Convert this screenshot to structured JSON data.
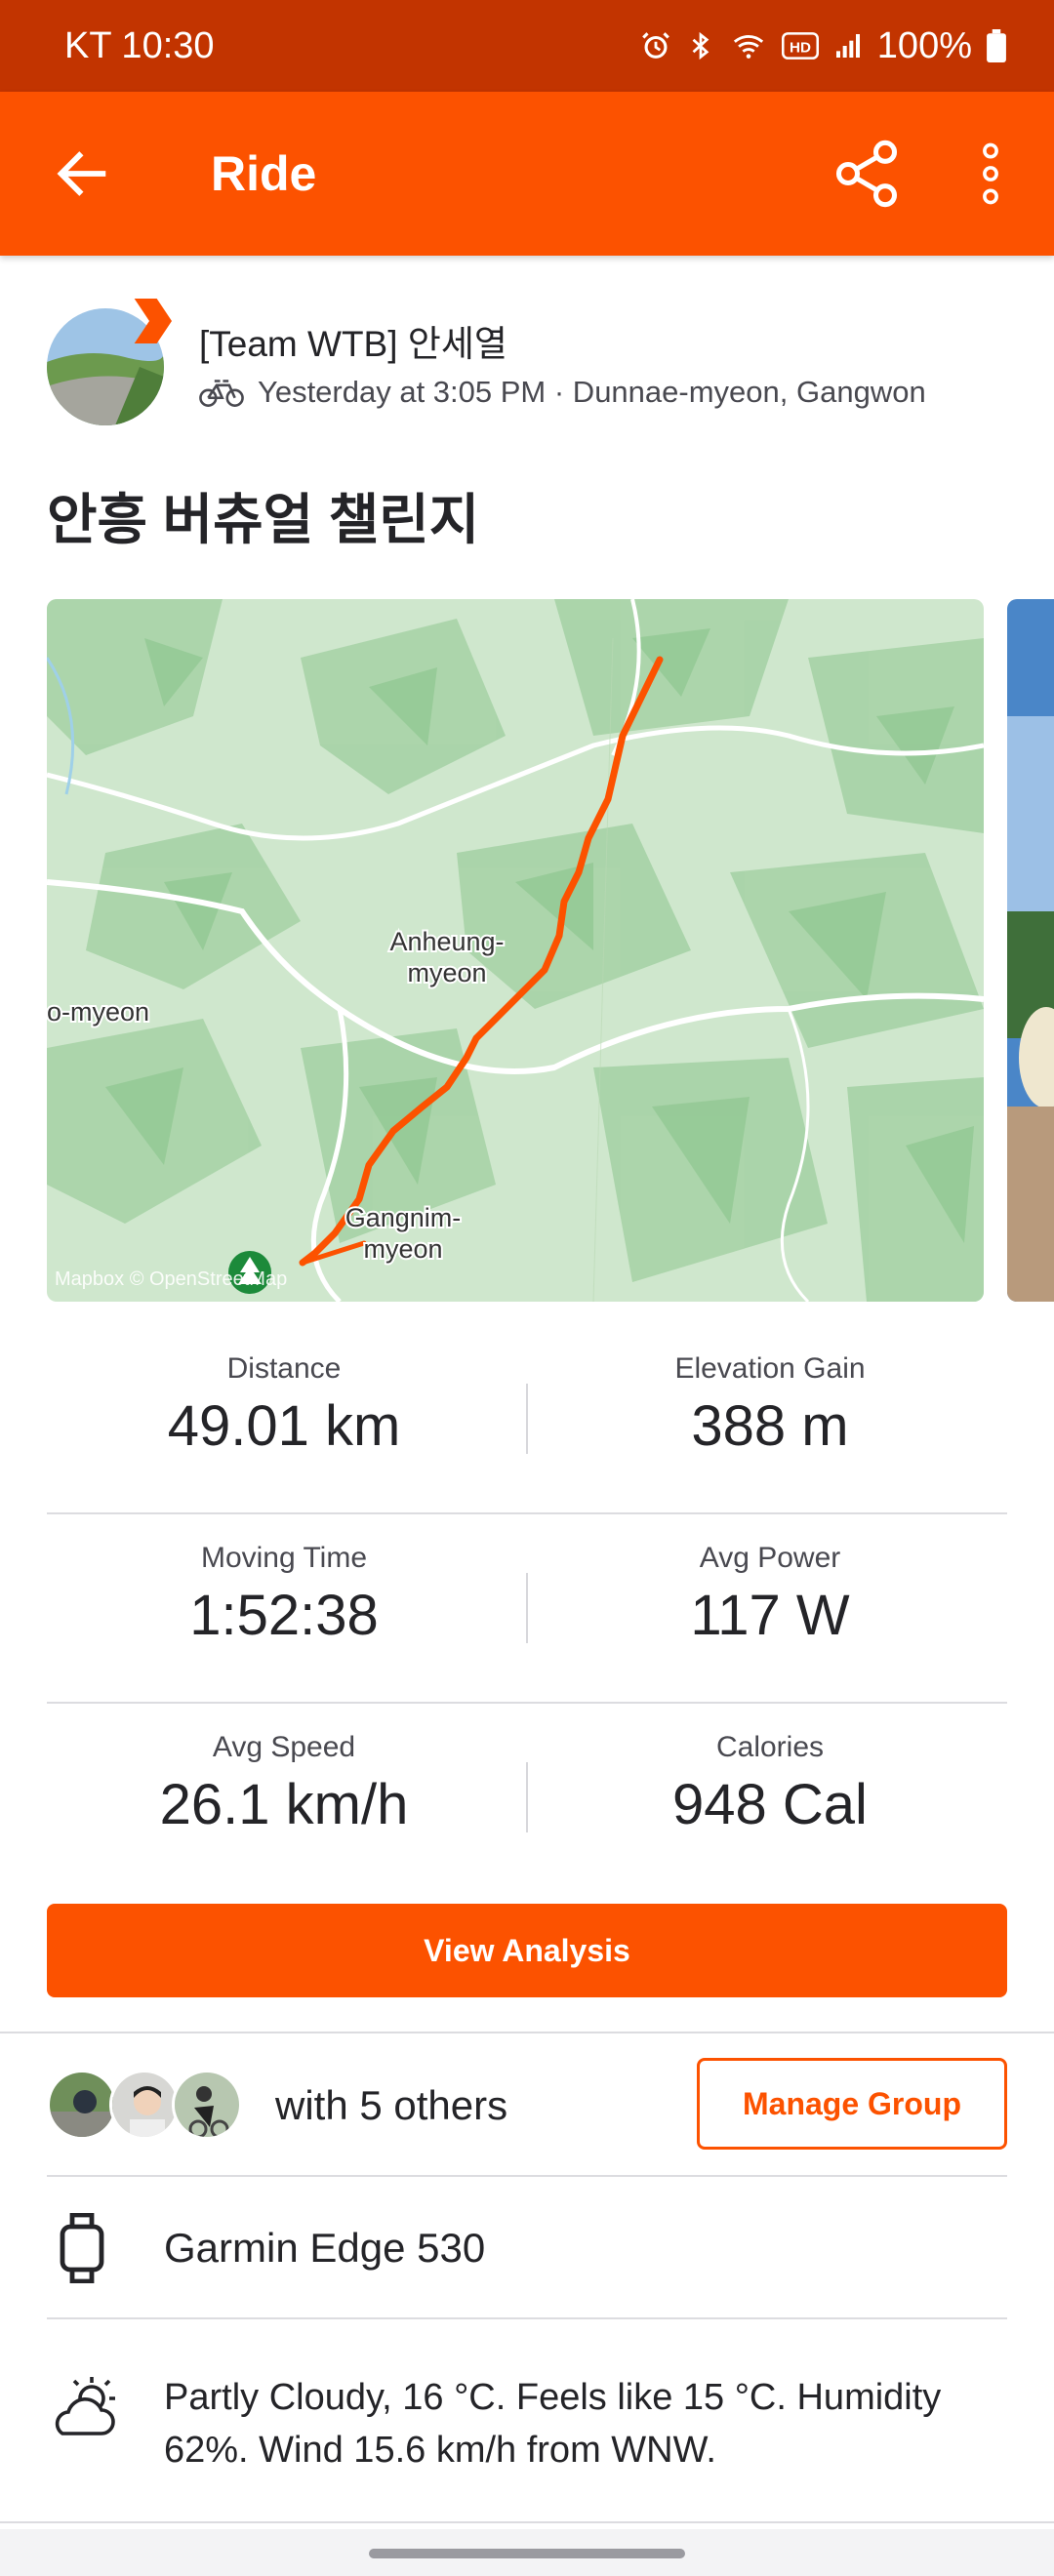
{
  "status_bar": {
    "carrier_time": "KT 10:30",
    "battery": "100%"
  },
  "app_bar": {
    "title": "Ride"
  },
  "activity": {
    "athlete_name": "[Team WTB] 안세열",
    "meta": "Yesterday at 3:05 PM · Dunnae-myeon, Gangwon",
    "title": "안흥 버츄얼 챌린지"
  },
  "map": {
    "labels": [
      "Anheung-",
      "myeon",
      "o-myeon",
      "Gangnim-",
      "myeon"
    ],
    "attribution": "Mapbox © OpenStreetMap"
  },
  "stats": [
    {
      "label": "Distance",
      "value": "49.01 km"
    },
    {
      "label": "Elevation Gain",
      "value": "388 m"
    },
    {
      "label": "Moving Time",
      "value": "1:52:38"
    },
    {
      "label": "Avg Power",
      "value": "117 W"
    },
    {
      "label": "Avg Speed",
      "value": "26.1 km/h"
    },
    {
      "label": "Calories",
      "value": "948 Cal"
    }
  ],
  "actions": {
    "view_analysis": "View Analysis",
    "manage_group": "Manage Group"
  },
  "group": {
    "with_others": "with 5 others"
  },
  "device": {
    "name": "Garmin Edge 530"
  },
  "weather": {
    "text": "Partly Cloudy, 16 °C. Feels like 15 °C. Humidity 62%. Wind 15.6 km/h from WNW."
  },
  "colors": {
    "brand": "#fc5200",
    "status_bar": "#c23400"
  },
  "icons": [
    "back-arrow-icon",
    "share-icon",
    "more-vert-icon",
    "bike-icon",
    "watch-icon",
    "partly-cloudy-icon"
  ]
}
